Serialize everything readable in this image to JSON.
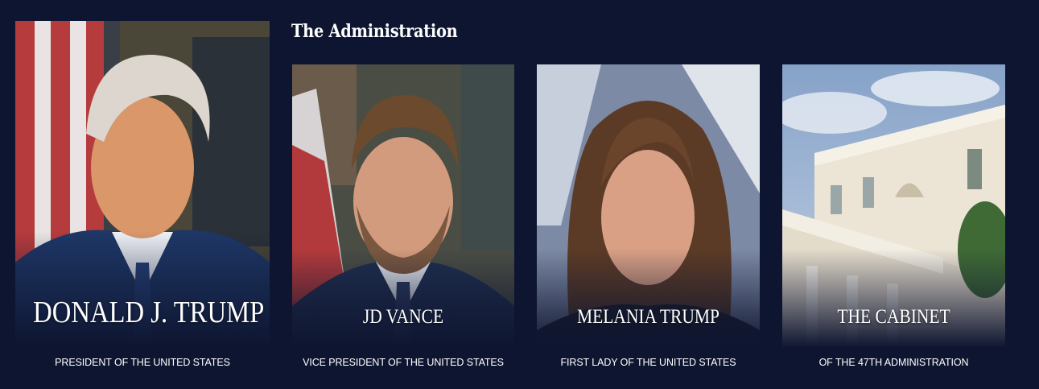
{
  "section": {
    "title": "The Administration"
  },
  "cards": [
    {
      "name": "DONALD J. TRUMP",
      "role": "PRESIDENT OF THE UNITED STATES"
    },
    {
      "name": "JD VANCE",
      "role": "VICE PRESIDENT OF THE UNITED STATES"
    },
    {
      "name": "MELANIA TRUMP",
      "role": "FIRST LADY OF THE UNITED STATES"
    },
    {
      "name": "THE CABINET",
      "role": "OF THE 47TH ADMINISTRATION"
    }
  ],
  "colors": {
    "background": "#0e1530",
    "text": "#ffffff"
  }
}
